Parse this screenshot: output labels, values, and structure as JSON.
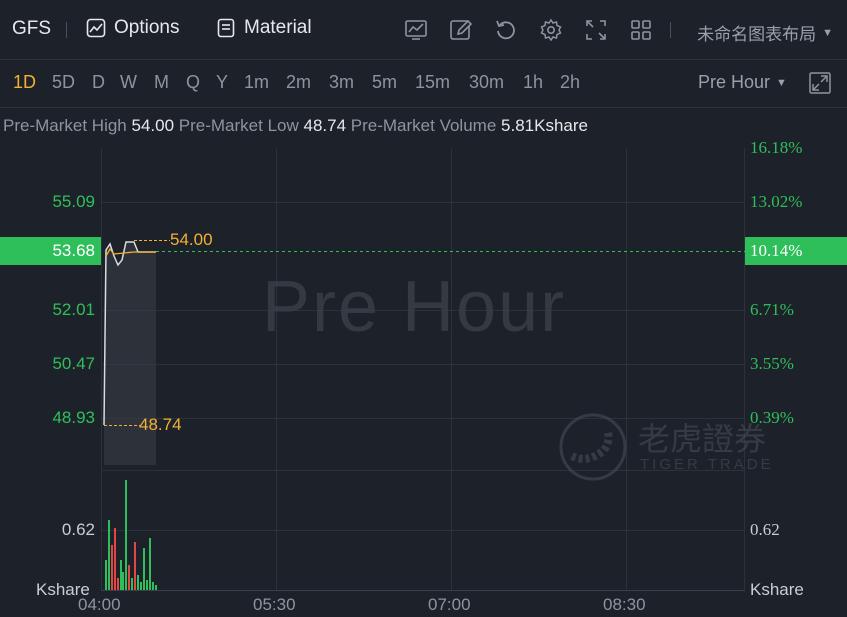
{
  "toolbar": {
    "symbol": "GFS",
    "options_label": "Options",
    "material_label": "Material",
    "layout_name": "未命名图表布局",
    "icons": [
      "indicator-chart-icon",
      "draw-pen-icon",
      "undo-icon",
      "settings-gear-icon",
      "fullscreen-icon",
      "layout-grid-icon"
    ]
  },
  "periods": [
    "1D",
    "5D",
    "D",
    "W",
    "M",
    "Q",
    "Y",
    "1m",
    "2m",
    "3m",
    "5m",
    "15m",
    "30m",
    "1h",
    "2h"
  ],
  "active_period": "1D",
  "session_select": "Pre Hour",
  "stats": {
    "high_label": "Pre-Market High",
    "high_value": "54.00",
    "low_label": "Pre-Market Low",
    "low_value": "48.74",
    "volume_label": "Pre-Market Volume",
    "volume_value": "5.81Kshare"
  },
  "chart": {
    "watermark": "Pre Hour",
    "brand_cn": "老虎證券",
    "brand_en": "TIGER TRADE",
    "left_axis": [
      "55.09",
      "52.01",
      "50.47",
      "48.93"
    ],
    "right_axis": [
      "16.18%",
      "13.02%",
      "6.71%",
      "3.55%",
      "0.39%"
    ],
    "last_price": "53.68",
    "last_pct": "10.14%",
    "high_marker": "54.00",
    "low_marker": "48.74",
    "volume_left": "0.62",
    "volume_right": "0.62",
    "volume_unit_left": "Kshare",
    "volume_unit_right": "Kshare",
    "time_labels": [
      "04:00",
      "05:30",
      "07:00",
      "08:30"
    ],
    "colors": {
      "up": "#2fbf5a",
      "down": "#e04848",
      "price_line": "#f2b134",
      "active": "#f2b134"
    }
  }
}
